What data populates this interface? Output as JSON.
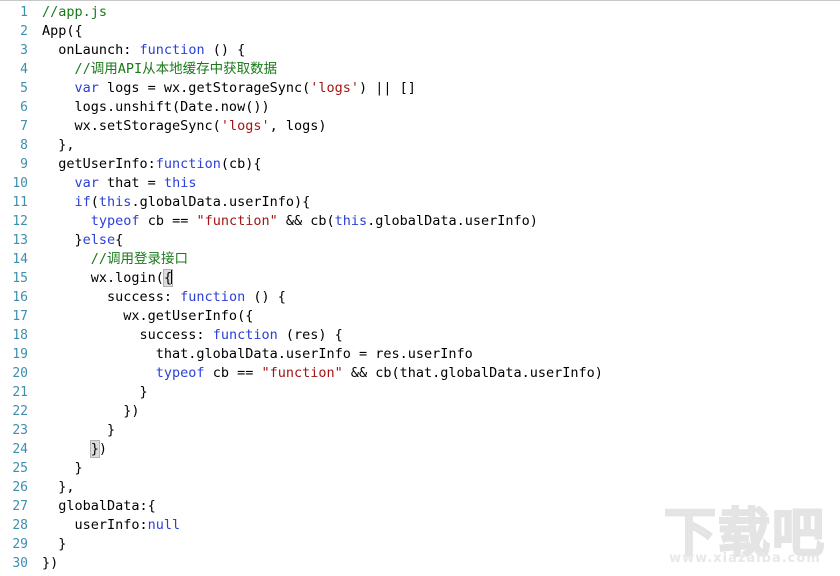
{
  "editor": {
    "language": "javascript",
    "total_lines": 30,
    "gutter_color": "#3d8faf",
    "background_color": "#ffffff",
    "colors": {
      "keyword": "#2b40d8",
      "comment": "#1a7a1a",
      "string": "#a31515",
      "plain": "#000000",
      "bracket_match_bg": "#dcdcdc"
    },
    "line_numbers": [
      "1",
      "2",
      "3",
      "4",
      "5",
      "6",
      "7",
      "8",
      "9",
      "10",
      "11",
      "12",
      "13",
      "14",
      "15",
      "16",
      "17",
      "18",
      "19",
      "20",
      "21",
      "22",
      "23",
      "24",
      "25",
      "26",
      "27",
      "28",
      "29",
      "30"
    ],
    "lines": [
      {
        "n": 1,
        "tokens": [
          {
            "t": "comment",
            "v": "//app.js"
          }
        ]
      },
      {
        "n": 2,
        "tokens": [
          {
            "t": "plain",
            "v": "App({"
          }
        ]
      },
      {
        "n": 3,
        "tokens": [
          {
            "t": "plain",
            "v": "  onLaunch: "
          },
          {
            "t": "keyword",
            "v": "function"
          },
          {
            "t": "plain",
            "v": " () {"
          }
        ]
      },
      {
        "n": 4,
        "tokens": [
          {
            "t": "plain",
            "v": "    "
          },
          {
            "t": "comment",
            "v": "//调用API从本地缓存中获取数据"
          }
        ]
      },
      {
        "n": 5,
        "tokens": [
          {
            "t": "plain",
            "v": "    "
          },
          {
            "t": "keyword",
            "v": "var"
          },
          {
            "t": "plain",
            "v": " logs = wx.getStorageSync("
          },
          {
            "t": "string",
            "v": "'logs'"
          },
          {
            "t": "plain",
            "v": ") || []"
          }
        ]
      },
      {
        "n": 6,
        "tokens": [
          {
            "t": "plain",
            "v": "    logs.unshift(Date.now())"
          }
        ]
      },
      {
        "n": 7,
        "tokens": [
          {
            "t": "plain",
            "v": "    wx.setStorageSync("
          },
          {
            "t": "string",
            "v": "'logs'"
          },
          {
            "t": "plain",
            "v": ", logs)"
          }
        ]
      },
      {
        "n": 8,
        "tokens": [
          {
            "t": "plain",
            "v": "  },"
          }
        ]
      },
      {
        "n": 9,
        "tokens": [
          {
            "t": "plain",
            "v": "  getUserInfo:"
          },
          {
            "t": "keyword",
            "v": "function"
          },
          {
            "t": "plain",
            "v": "(cb){"
          }
        ]
      },
      {
        "n": 10,
        "tokens": [
          {
            "t": "plain",
            "v": "    "
          },
          {
            "t": "keyword",
            "v": "var"
          },
          {
            "t": "plain",
            "v": " that = "
          },
          {
            "t": "keyword",
            "v": "this"
          }
        ]
      },
      {
        "n": 11,
        "tokens": [
          {
            "t": "plain",
            "v": "    "
          },
          {
            "t": "keyword",
            "v": "if"
          },
          {
            "t": "plain",
            "v": "("
          },
          {
            "t": "keyword",
            "v": "this"
          },
          {
            "t": "plain",
            "v": ".globalData.userInfo){"
          }
        ]
      },
      {
        "n": 12,
        "tokens": [
          {
            "t": "plain",
            "v": "      "
          },
          {
            "t": "keyword",
            "v": "typeof"
          },
          {
            "t": "plain",
            "v": " cb == "
          },
          {
            "t": "string",
            "v": "\"function\""
          },
          {
            "t": "plain",
            "v": " && cb("
          },
          {
            "t": "keyword",
            "v": "this"
          },
          {
            "t": "plain",
            "v": ".globalData.userInfo)"
          }
        ]
      },
      {
        "n": 13,
        "tokens": [
          {
            "t": "plain",
            "v": "    }"
          },
          {
            "t": "keyword",
            "v": "else"
          },
          {
            "t": "plain",
            "v": "{"
          }
        ]
      },
      {
        "n": 14,
        "tokens": [
          {
            "t": "plain",
            "v": "      "
          },
          {
            "t": "comment",
            "v": "//调用登录接口"
          }
        ]
      },
      {
        "n": 15,
        "tokens": [
          {
            "t": "plain",
            "v": "      wx.login("
          },
          {
            "t": "bracket-match",
            "v": "{"
          },
          {
            "t": "caret",
            "v": ""
          }
        ]
      },
      {
        "n": 16,
        "tokens": [
          {
            "t": "plain",
            "v": "        success: "
          },
          {
            "t": "keyword",
            "v": "function"
          },
          {
            "t": "plain",
            "v": " () {"
          }
        ]
      },
      {
        "n": 17,
        "tokens": [
          {
            "t": "plain",
            "v": "          wx.getUserInfo({"
          }
        ]
      },
      {
        "n": 18,
        "tokens": [
          {
            "t": "plain",
            "v": "            success: "
          },
          {
            "t": "keyword",
            "v": "function"
          },
          {
            "t": "plain",
            "v": " (res) {"
          }
        ]
      },
      {
        "n": 19,
        "tokens": [
          {
            "t": "plain",
            "v": "              that.globalData.userInfo = res.userInfo"
          }
        ]
      },
      {
        "n": 20,
        "tokens": [
          {
            "t": "plain",
            "v": "              "
          },
          {
            "t": "keyword",
            "v": "typeof"
          },
          {
            "t": "plain",
            "v": " cb == "
          },
          {
            "t": "string",
            "v": "\"function\""
          },
          {
            "t": "plain",
            "v": " && cb(that.globalData.userInfo)"
          }
        ]
      },
      {
        "n": 21,
        "tokens": [
          {
            "t": "plain",
            "v": "            }"
          }
        ]
      },
      {
        "n": 22,
        "tokens": [
          {
            "t": "plain",
            "v": "          })"
          }
        ]
      },
      {
        "n": 23,
        "tokens": [
          {
            "t": "plain",
            "v": "        }"
          }
        ]
      },
      {
        "n": 24,
        "tokens": [
          {
            "t": "plain",
            "v": "      "
          },
          {
            "t": "bracket-match",
            "v": "}"
          },
          {
            "t": "plain",
            "v": ")"
          }
        ]
      },
      {
        "n": 25,
        "tokens": [
          {
            "t": "plain",
            "v": "    }"
          }
        ]
      },
      {
        "n": 26,
        "tokens": [
          {
            "t": "plain",
            "v": "  },"
          }
        ]
      },
      {
        "n": 27,
        "tokens": [
          {
            "t": "plain",
            "v": "  globalData:{"
          }
        ]
      },
      {
        "n": 28,
        "tokens": [
          {
            "t": "plain",
            "v": "    userInfo:"
          },
          {
            "t": "keyword",
            "v": "null"
          }
        ]
      },
      {
        "n": 29,
        "tokens": [
          {
            "t": "plain",
            "v": "  }"
          }
        ]
      },
      {
        "n": 30,
        "tokens": [
          {
            "t": "plain",
            "v": "})"
          }
        ]
      }
    ]
  },
  "watermark": {
    "text": "下载吧",
    "url": "www.xiazaiba.com"
  }
}
